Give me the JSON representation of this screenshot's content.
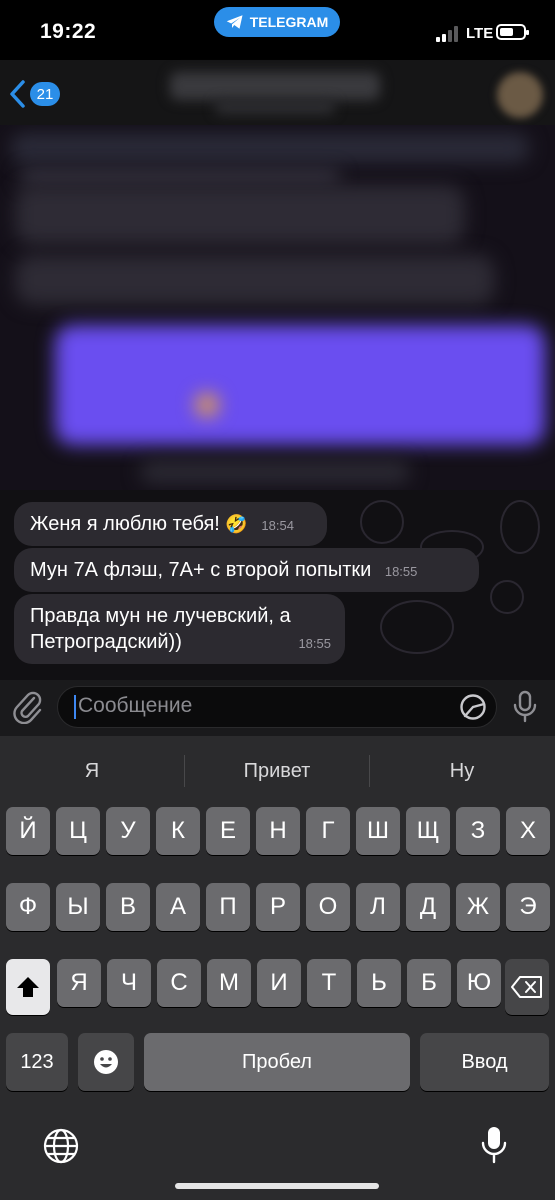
{
  "status": {
    "time": "19:22",
    "app_pill": "TELEGRAM",
    "network": "LTE"
  },
  "header": {
    "back_count": "21"
  },
  "messages": [
    {
      "text": "Женя я люблю тебя!",
      "emoji": "🤣",
      "time": "18:54"
    },
    {
      "text": "Мун 7А флэш, 7А+ с второй попытки",
      "time": "18:55"
    },
    {
      "text": "Правда мун не лучевский, а Петроградский))",
      "time": "18:55"
    }
  ],
  "input": {
    "placeholder": "Сообщение"
  },
  "keyboard": {
    "suggestions": [
      "Я",
      "Привет",
      "Ну"
    ],
    "row1": [
      "Й",
      "Ц",
      "У",
      "К",
      "Е",
      "Н",
      "Г",
      "Ш",
      "Щ",
      "З",
      "Х"
    ],
    "row2": [
      "Ф",
      "Ы",
      "В",
      "А",
      "П",
      "Р",
      "О",
      "Л",
      "Д",
      "Ж",
      "Э"
    ],
    "row3": [
      "Я",
      "Ч",
      "С",
      "М",
      "И",
      "Т",
      "Ь",
      "Б",
      "Ю"
    ],
    "numbers_label": "123",
    "space_label": "Пробел",
    "return_label": "Ввод"
  },
  "colors": {
    "accent": "#2b8ee8",
    "bubble": "#2c2a30",
    "keyboard_bg": "#2b2b2d"
  },
  "icons": [
    "telegram-plane-icon",
    "signal-icon",
    "battery-icon",
    "back-chevron-icon",
    "paperclip-icon",
    "sticker-icon",
    "microphone-icon",
    "shift-icon",
    "backspace-icon",
    "emoji-icon",
    "globe-icon",
    "dictation-mic-icon"
  ]
}
